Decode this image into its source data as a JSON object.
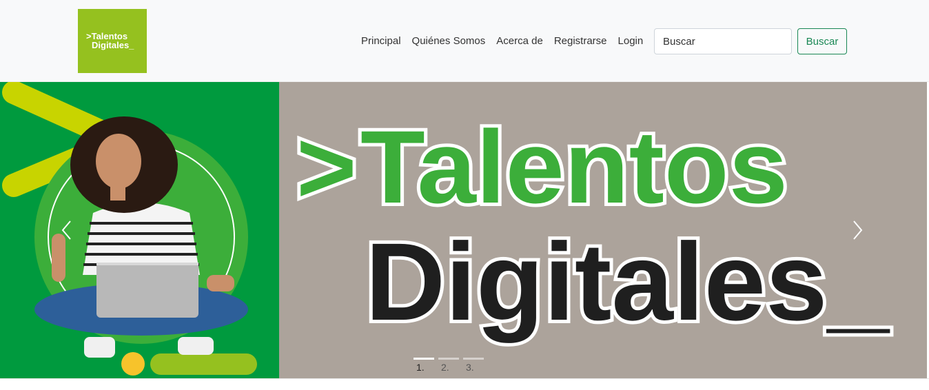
{
  "brand": {
    "logo_line1": ">Talentos",
    "logo_line2": "Digitales_"
  },
  "nav": {
    "items": [
      {
        "label": "Principal"
      },
      {
        "label": "Quiénes Somos"
      },
      {
        "label": "Acerca de"
      },
      {
        "label": "Registrarse"
      },
      {
        "label": "Login"
      }
    ]
  },
  "search": {
    "placeholder": "Buscar",
    "button_label": "Buscar"
  },
  "carousel": {
    "banner_line1_prefix": ">",
    "banner_line1_word": "Talentos",
    "banner_line2": "Digitales_",
    "prev_icon": "chevron-left-icon",
    "next_icon": "chevron-right-icon",
    "indicators": [
      "1.",
      "2.",
      "3."
    ],
    "active_index": 0
  },
  "colors": {
    "brand_green": "#95c11f",
    "banner_green": "#009a3e",
    "banner_gray": "#aca39b",
    "text_green": "#3cae3a",
    "accent_yellow": "#c8d400",
    "button_outline": "#198754"
  }
}
